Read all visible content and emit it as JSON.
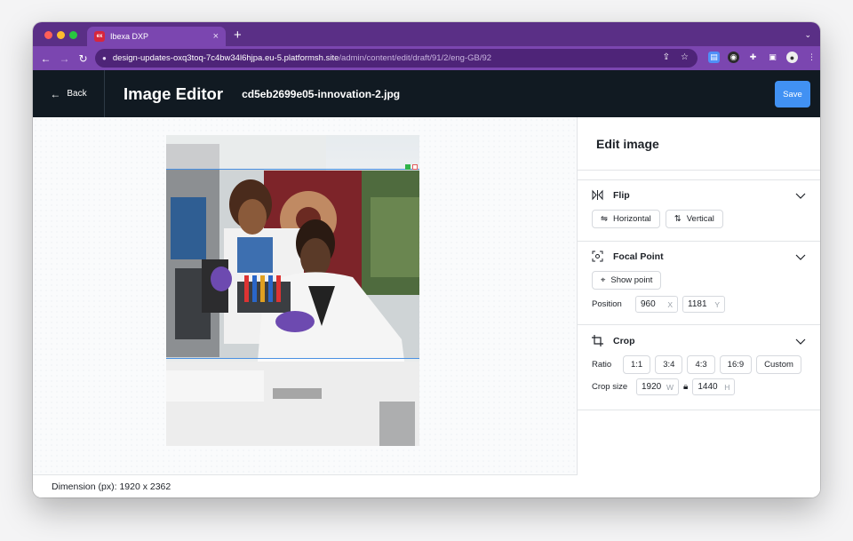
{
  "browser": {
    "tab_title": "Ibexa DXP",
    "favicon_text": "ex",
    "url_host": "design-updates-oxq3toq-7c4bw34l6hjpa.eu-5.platformsh.site",
    "url_path": "/admin/content/edit/draft/91/2/eng-GB/92"
  },
  "header": {
    "back_label": "Back",
    "title": "Image Editor",
    "filename": "cd5eb2699e05-innovation-2.jpg",
    "save_label": "Save"
  },
  "canvas": {
    "dimension_text": "Dimension (px): 1920 x 2362"
  },
  "panel": {
    "title": "Edit image",
    "flip": {
      "title": "Flip",
      "horizontal_label": "Horizontal",
      "vertical_label": "Vertical"
    },
    "focal_point": {
      "title": "Focal Point",
      "show_point_label": "Show point",
      "position_label": "Position",
      "x_value": "960",
      "x_unit": "X",
      "y_value": "1181",
      "y_unit": "Y"
    },
    "crop": {
      "title": "Crop",
      "ratio_label": "Ratio",
      "ratios": [
        "1:1",
        "3:4",
        "4:3",
        "16:9",
        "Custom"
      ],
      "size_label": "Crop size",
      "width_value": "1920",
      "width_unit": "W",
      "height_value": "1440",
      "height_unit": "H"
    }
  },
  "colors": {
    "tab_strip": "#5a2f86",
    "toolbar": "#7b46b0",
    "app_header": "#111a22",
    "accent": "#4191f3",
    "crop_line": "#4a90e2"
  }
}
